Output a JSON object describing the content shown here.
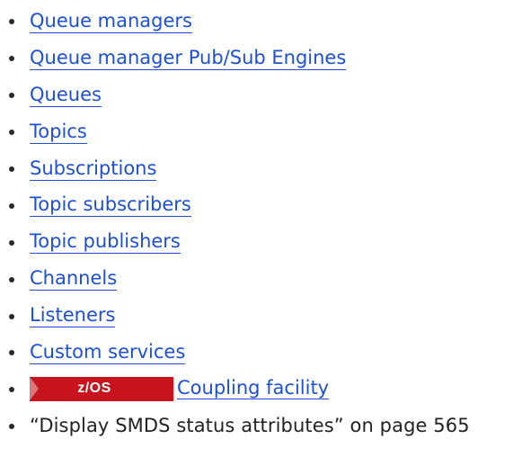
{
  "items": [
    {
      "label": "Queue managers",
      "kind": "link"
    },
    {
      "label": "Queue manager Pub/Sub Engines",
      "kind": "link"
    },
    {
      "label": "Queues",
      "kind": "link"
    },
    {
      "label": "Topics",
      "kind": "link"
    },
    {
      "label": "Subscriptions",
      "kind": "link"
    },
    {
      "label": "Topic subscribers",
      "kind": "link"
    },
    {
      "label": "Topic publishers",
      "kind": "link"
    },
    {
      "label": "Channels",
      "kind": "link"
    },
    {
      "label": "Listeners",
      "kind": "link"
    },
    {
      "label": "Custom services",
      "kind": "link"
    },
    {
      "label": "Coupling facility",
      "kind": "link",
      "badge": "z/OS"
    },
    {
      "label": "“Display SMDS status attributes” on page 565",
      "kind": "text"
    }
  ],
  "colors": {
    "link": "#1d4fd8",
    "badge_bg": "#c8141e",
    "badge_text": "#ffffff"
  }
}
